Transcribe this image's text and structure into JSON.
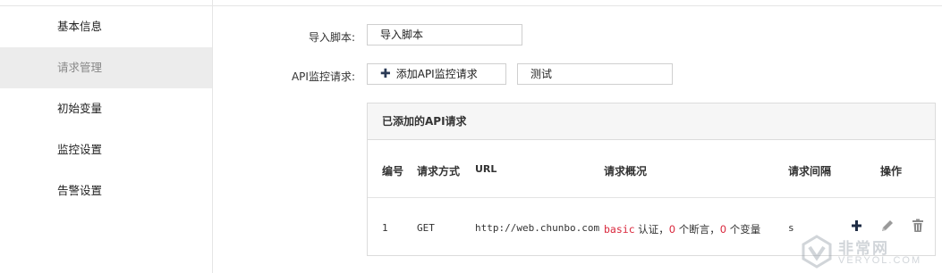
{
  "sidebar": {
    "items": [
      {
        "label": "基本信息"
      },
      {
        "label": "请求管理"
      },
      {
        "label": "初始变量"
      },
      {
        "label": "监控设置"
      },
      {
        "label": "告警设置"
      }
    ],
    "active_index": 1
  },
  "form": {
    "import_label": "导入脚本:",
    "import_value": "导入脚本",
    "api_label": "API监控请求:",
    "add_button_label": "添加API监控请求",
    "test_value": "测试"
  },
  "panel": {
    "title": "已添加的API请求",
    "columns": [
      "编号",
      "请求方式",
      "URL",
      "请求概况",
      "请求间隔",
      "操作"
    ],
    "rows": [
      {
        "id": "1",
        "method": "GET",
        "url": "http://web.chunbo.com",
        "summary": {
          "auth": "basic",
          "auth_suffix": " 认证，",
          "assert_count": "0",
          "assert_suffix": " 个断言，",
          "var_count": "0",
          "var_suffix": " 个变量"
        },
        "interval": "s"
      }
    ]
  },
  "watermark": {
    "cn": "非常网",
    "en": "VERYOL.COM"
  }
}
